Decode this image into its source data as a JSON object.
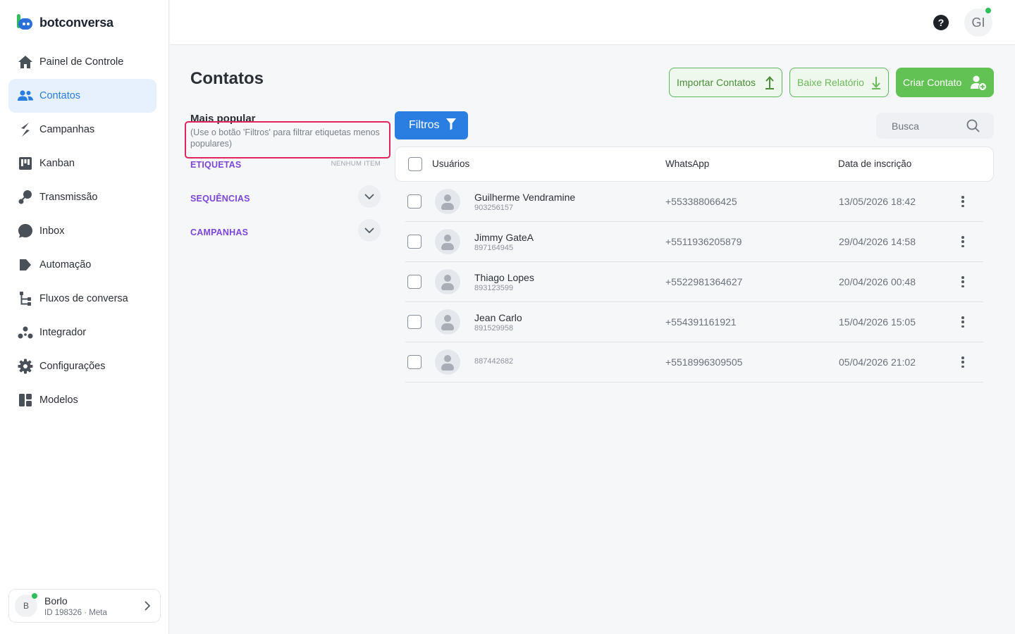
{
  "app": {
    "brand": "botconversa"
  },
  "sidebar": {
    "items": [
      {
        "label": "Painel de Controle",
        "icon": "home-icon",
        "active": false
      },
      {
        "label": "Contatos",
        "icon": "users-icon",
        "active": true
      },
      {
        "label": "Campanhas",
        "icon": "campaign-icon",
        "active": false
      },
      {
        "label": "Kanban",
        "icon": "kanban-icon",
        "active": false
      },
      {
        "label": "Transmissão",
        "icon": "broadcast-icon",
        "active": false
      },
      {
        "label": "Inbox",
        "icon": "chat-bubble-icon",
        "active": false
      },
      {
        "label": "Automação",
        "icon": "automation-icon",
        "active": false
      },
      {
        "label": "Fluxos de conversa",
        "icon": "flow-icon",
        "active": false
      },
      {
        "label": "Integrador",
        "icon": "integrator-icon",
        "active": false
      },
      {
        "label": "Configurações",
        "icon": "gear-icon",
        "active": false
      },
      {
        "label": "Modelos",
        "icon": "templates-icon",
        "active": false
      }
    ],
    "account": {
      "initial": "B",
      "name": "Borlo",
      "subtitle": "ID 198326 · Meta"
    }
  },
  "topbar": {
    "help": "?",
    "user_initials": "GI"
  },
  "page": {
    "title": "Contatos",
    "buttons": {
      "import": "Importar Contatos",
      "report": "Baixe Relatório",
      "create": "Criar Contato"
    },
    "filters_label": "Filtros",
    "search_placeholder": "Busca"
  },
  "filters_panel": {
    "title": "Mais popular",
    "hint": "(Use o botão 'Filtros' para filtrar etiquetas menos populares)",
    "groups": [
      {
        "label": "ETIQUETAS",
        "empty_text": "NENHUM ITEM"
      },
      {
        "label": "SEQUÊNCIAS"
      },
      {
        "label": "CAMPANHAS"
      }
    ]
  },
  "table": {
    "columns": [
      "Usuários",
      "WhatsApp",
      "Data de inscrição"
    ],
    "rows": [
      {
        "name": "Guilherme Vendramine",
        "id": "903256157",
        "whatsapp": "+553388066425",
        "date": "13/05/2026 18:42"
      },
      {
        "name": "Jimmy GateA",
        "id": "897164945",
        "whatsapp": "+5511936205879",
        "date": "29/04/2026 14:58"
      },
      {
        "name": "Thiago Lopes",
        "id": "893123599",
        "whatsapp": "+5522981364627",
        "date": "20/04/2026 00:48"
      },
      {
        "name": "Jean Carlo",
        "id": "891529958",
        "whatsapp": "+554391161921",
        "date": "15/04/2026 15:05"
      },
      {
        "name": "",
        "id": "887442682",
        "whatsapp": "+5518996309505",
        "date": "05/04/2026 21:02"
      }
    ]
  },
  "colors": {
    "primary": "#2a7de1",
    "success": "#62c254",
    "accent_purple": "#7b46d9",
    "highlight": "#e0245e"
  }
}
